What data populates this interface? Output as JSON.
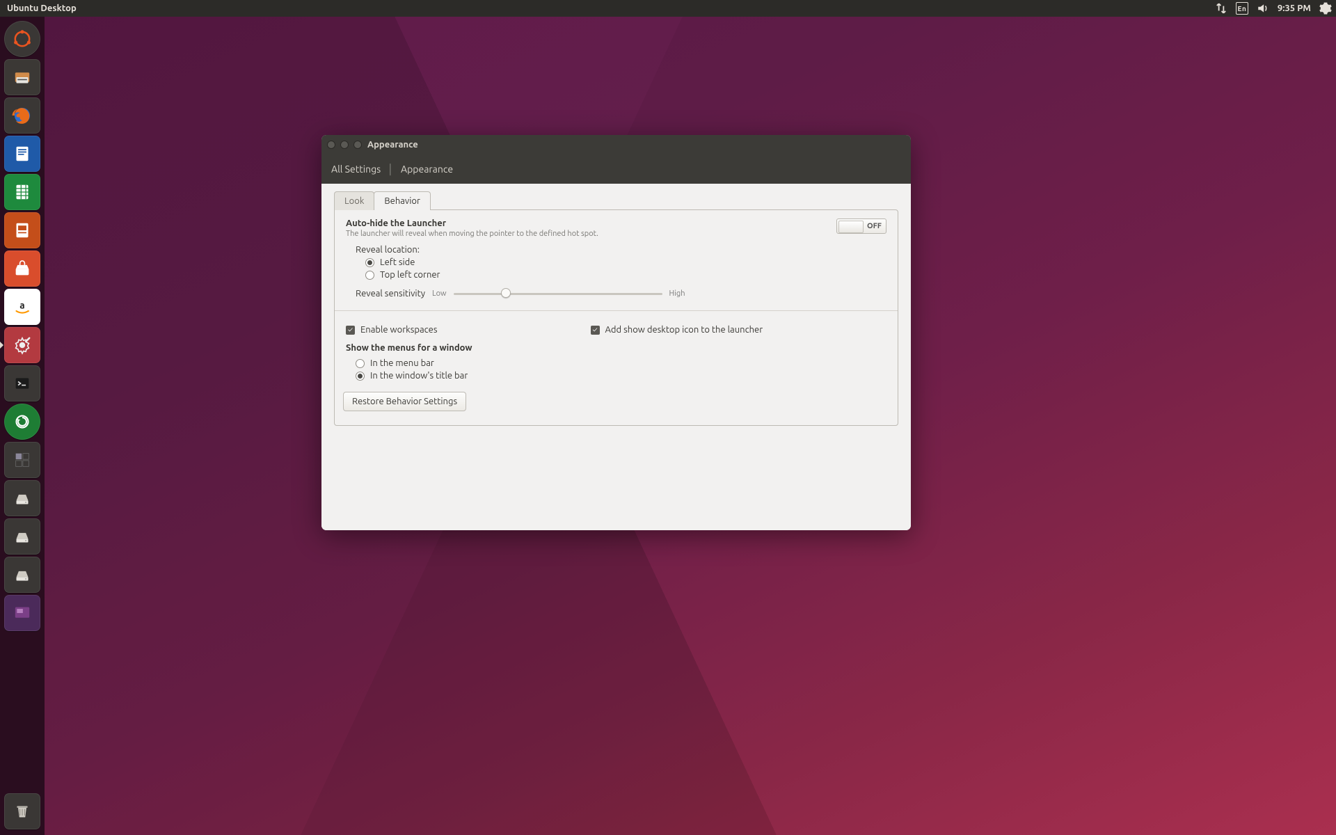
{
  "panel": {
    "title": "Ubuntu Desktop",
    "lang": "En",
    "clock": "9:35 PM"
  },
  "launcher": {
    "items": [
      "dash",
      "files",
      "firefox",
      "writer",
      "calc",
      "impress",
      "software",
      "amazon",
      "settings",
      "terminal",
      "updater",
      "workspace",
      "drive",
      "drive",
      "drive",
      "desktop-icon"
    ],
    "running": "settings",
    "trash": "trash"
  },
  "window": {
    "title": "Appearance",
    "breadcrumb": [
      "All Settings",
      "Appearance"
    ],
    "tabs": {
      "look": "Look",
      "behavior": "Behavior",
      "active": "behavior"
    },
    "autohide": {
      "heading": "Auto-hide the Launcher",
      "sub": "The launcher will reveal when moving the pointer to the defined hot spot.",
      "switch": "OFF",
      "reveal_label": "Reveal location:",
      "opts": {
        "left": "Left side",
        "corner": "Top left corner",
        "selected": "left"
      },
      "sensitivity": {
        "label": "Reveal sensitivity",
        "low": "Low",
        "high": "High",
        "value": 25
      }
    },
    "checks": {
      "workspaces": {
        "label": "Enable workspaces",
        "checked": true
      },
      "show_desktop": {
        "label": "Add show desktop icon to the launcher",
        "checked": true
      }
    },
    "menus": {
      "heading": "Show the menus for a window",
      "menu_bar": "In the menu bar",
      "title_bar": "In the window's title bar",
      "selected": "title_bar"
    },
    "restore": "Restore Behavior Settings"
  }
}
